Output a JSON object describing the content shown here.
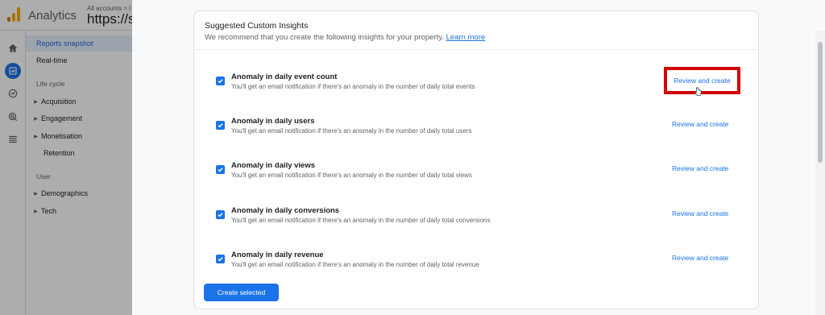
{
  "app": {
    "name": "Analytics",
    "breadcrumb": "All accounts > l",
    "property": "https://so"
  },
  "sidenav": {
    "items": [
      {
        "label": "Reports snapshot",
        "selected": true
      },
      {
        "label": "Real-time"
      }
    ],
    "sections": [
      {
        "label": "Life cycle",
        "items": [
          {
            "label": "Acquisition",
            "expandable": true
          },
          {
            "label": "Engagement",
            "expandable": true
          },
          {
            "label": "Monetisation",
            "expandable": true
          },
          {
            "label": "Retention",
            "expandable": false
          }
        ]
      },
      {
        "label": "User",
        "items": [
          {
            "label": "Demographics",
            "expandable": true
          },
          {
            "label": "Tech",
            "expandable": true
          }
        ]
      }
    ]
  },
  "dialog": {
    "title": "Suggested Custom Insights",
    "subtitle": "We recommend that you create the following insights for your property.",
    "learn_more": "Learn more",
    "insights": [
      {
        "title": "Anomaly in daily event count",
        "description": "You'll get an email notification if there's an anomaly in the number of daily total events",
        "action": "Review and create",
        "checked": true
      },
      {
        "title": "Anomaly in daily users",
        "description": "You'll get an email notification if there's an anomaly in the number of daily total users",
        "action": "Review and create",
        "checked": true
      },
      {
        "title": "Anomaly in daily views",
        "description": "You'll get an email notification if there's an anomaly in the number of daily total views",
        "action": "Review and create",
        "checked": true
      },
      {
        "title": "Anomaly in daily conversions",
        "description": "You'll get an email notification if there's an anomaly in the number of daily total conversions",
        "action": "Review and create",
        "checked": true
      },
      {
        "title": "Anomaly in daily revenue",
        "description": "You'll get an email notification if there's an anomaly in the number of daily total revenue",
        "action": "Review and create",
        "checked": true
      }
    ],
    "create_button": "Create selected"
  },
  "colors": {
    "accent": "#1a73e8",
    "highlight": "#d50000"
  },
  "icons": [
    "home-icon",
    "reports-icon",
    "explore-icon",
    "advertising-icon",
    "configure-icon",
    "checkbox-checked-icon",
    "pointer-cursor-icon"
  ]
}
